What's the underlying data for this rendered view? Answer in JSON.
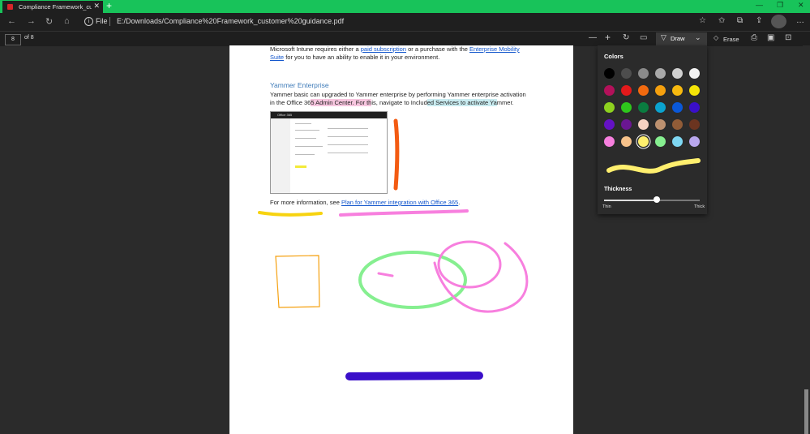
{
  "tab": {
    "title": "Compliance Framework_custome",
    "close": "✕",
    "new": "+"
  },
  "window": {
    "minimize": "—",
    "restore": "❐",
    "close": "✕"
  },
  "address": {
    "file_label": "File",
    "url": "E:/Downloads/Compliance%20Framework_customer%20guidance.pdf"
  },
  "pdf_toolbar": {
    "page_value": "8",
    "page_of": "of 8",
    "draw_label": "Draw",
    "erase_label": "Erase"
  },
  "page": {
    "line1_a": "Microsoft Intune requires either a ",
    "line1_link1": "paid subscription",
    "line1_b": " or a purchase with the ",
    "line1_link2": "Enterprise Mobility",
    "line2_link": "Suite",
    "line2_b": " for you to have an ability to enable it in your environment.",
    "yammer_title": "Yammer Enterprise",
    "para1_line1": "Yammer basic can upgraded to Yammer enterprise by performing Yammer enterprise activation",
    "para1_line2_a": "in the Office 36",
    "para1_line2_hl1": "5 Admin Center. For th",
    "para1_line2_b": "is, navigate to Includ",
    "para1_line2_hl2": "ed Services to activate Ya",
    "para1_line2_c": "mmer.",
    "thumb_label": "Office 365",
    "more_info_a": "For more information, see ",
    "more_info_link": "Plan for Yammer integration with Office 365",
    "more_info_b": "."
  },
  "flyout": {
    "colors_heading": "Colors",
    "thickness_heading": "Thickness",
    "thin_label": "Thin",
    "thick_label": "Thick",
    "thickness_value": 0.55,
    "selected_color": "#ffef6e",
    "swatches": [
      [
        "#000000",
        "#4d4d4d",
        "#8a8a8a",
        "#a9a9a9",
        "#d0d0d0",
        "#f2f2f2"
      ],
      [
        "#b3115a",
        "#e3191b",
        "#f26a0f",
        "#f5a00e",
        "#f7b90f",
        "#f5e507"
      ],
      [
        "#8ed11f",
        "#2ec71c",
        "#0a7c40",
        "#0ba3cf",
        "#0a58d8",
        "#3a0fc9"
      ],
      [
        "#6412c4",
        "#6a1692",
        "#f5d2c2",
        "#bd916f",
        "#915c37",
        "#6b3420"
      ],
      [
        "#f77fde",
        "#f7c28a",
        "#ffef6e",
        "#86ef90",
        "#7ed7f2",
        "#b9a7ee"
      ]
    ]
  },
  "icons": {
    "back": "back-arrow-icon",
    "forward": "forward-arrow-icon",
    "refresh": "refresh-icon",
    "home": "home-icon",
    "info": "info-icon",
    "favorite": "star-icon",
    "favorites": "favorites-icon",
    "collections": "collections-icon",
    "share": "share-icon",
    "zoom_out": "minus-icon",
    "zoom_in": "plus-icon",
    "rotate": "rotate-icon",
    "fit": "fit-page-icon",
    "draw": "pen-icon",
    "erase": "eraser-icon",
    "print": "print-icon",
    "save": "save-icon",
    "pin": "pin-icon"
  }
}
